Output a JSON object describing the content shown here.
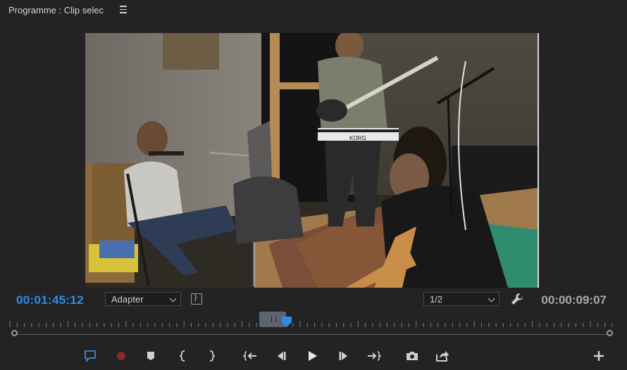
{
  "panel": {
    "title": "Programme : Clip selec"
  },
  "viewer": {
    "instrument_label": "KORG"
  },
  "playback": {
    "current_timecode": "00:01:45:12",
    "duration_timecode": "00:00:09:07",
    "zoom_value": "Adapter",
    "resolution_value": "1/2"
  },
  "colors": {
    "timecode_accent": "#2d8ceb",
    "playhead": "#2d8ceb",
    "record": "#c0392b"
  },
  "controls": [
    "add-marker-comment-icon",
    "record-icon",
    "marker-icon",
    "mark-in-icon",
    "mark-out-icon",
    "go-to-in-icon",
    "step-back-icon",
    "play-icon",
    "step-forward-icon",
    "go-to-out-icon",
    "export-frame-icon",
    "insert-export-icon",
    "add-button-icon"
  ]
}
